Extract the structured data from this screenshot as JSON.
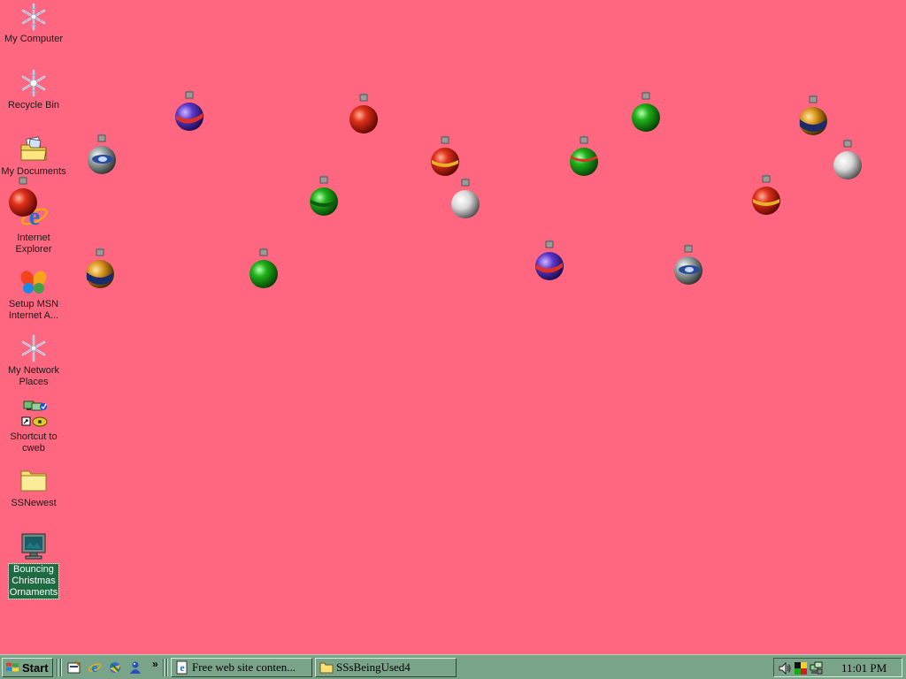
{
  "desktop": {
    "background_color": "#FF6680",
    "icons": [
      {
        "label": "My Computer",
        "icon": "snowflake-icon"
      },
      {
        "label": "Recycle Bin",
        "icon": "snowflake-icon"
      },
      {
        "label": "My Documents",
        "icon": "folder-documents-icon"
      },
      {
        "label": "Internet\nExplorer",
        "icon": "internet-explorer-icon"
      },
      {
        "label": "Setup MSN\nInternet A...",
        "icon": "msn-butterfly-icon"
      },
      {
        "label": "My Network\nPlaces",
        "icon": "snowflake-icon"
      },
      {
        "label": "Shortcut to\ncweb",
        "icon": "network-shortcut-icon"
      },
      {
        "label": "SSNewest",
        "icon": "folder-icon"
      },
      {
        "label": "Bouncing\nChristmas\nOrnaments",
        "icon": "screensaver-monitor-icon",
        "selected": true
      }
    ],
    "ornaments": [
      {
        "style": "purple-band"
      },
      {
        "style": "red"
      },
      {
        "style": "green"
      },
      {
        "style": "gold-blue"
      },
      {
        "style": "blue-eye"
      },
      {
        "style": "red-band"
      },
      {
        "style": "green-red"
      },
      {
        "style": "white"
      },
      {
        "style": "red"
      },
      {
        "style": "green-band"
      },
      {
        "style": "white"
      },
      {
        "style": "red-band"
      },
      {
        "style": "gold-blue"
      },
      {
        "style": "green"
      },
      {
        "style": "purple-band"
      },
      {
        "style": "blue-eye"
      }
    ]
  },
  "taskbar": {
    "background_color": "#7aa48a",
    "start_label": "Start",
    "quick_launch": [
      {
        "icon": "show-desktop-icon"
      },
      {
        "icon": "internet-explorer-icon"
      },
      {
        "icon": "outlook-express-icon"
      },
      {
        "icon": "msn-messenger-icon"
      }
    ],
    "chevron": "»",
    "tasks": [
      {
        "label": "Free web site conten...",
        "icon": "ie-page-icon"
      },
      {
        "label": "SSsBeingUsed4",
        "icon": "folder-icon"
      }
    ],
    "tray": {
      "icons": [
        {
          "icon": "speaker-icon"
        },
        {
          "icon": "color-squares-icon"
        },
        {
          "icon": "network-computers-icon"
        }
      ],
      "clock": "11:01 PM"
    }
  }
}
